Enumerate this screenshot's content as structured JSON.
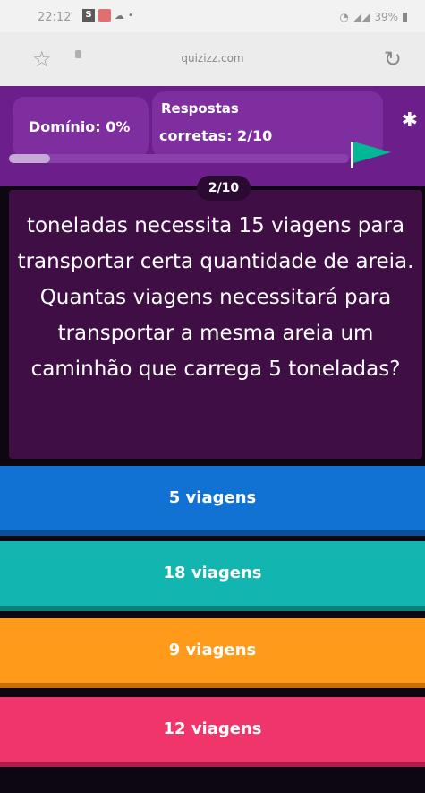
{
  "status_bar": {
    "time": "22:12",
    "battery": "39%"
  },
  "browser": {
    "url": "quizizz.com"
  },
  "quiz_header": {
    "score_label": "Domínio: 0%",
    "answers_line1": "Respostas",
    "answers_line2": "corretas: 2/10",
    "progress": 0.12
  },
  "question": {
    "counter": "2/10",
    "text": "toneladas necessita 15 viagens para transportar certa quantidade de areia. Quantas viagens necessitará para transportar a mesma areia um caminhão que carrega 5 toneladas?"
  },
  "answers": [
    {
      "label": "5 viagens",
      "color": "#1172d3"
    },
    {
      "label": "18 viagens",
      "color": "#12b5b0"
    },
    {
      "label": "9 viagens",
      "color": "#ff9a1a"
    },
    {
      "label": "12 viagens",
      "color": "#f0356b"
    }
  ]
}
